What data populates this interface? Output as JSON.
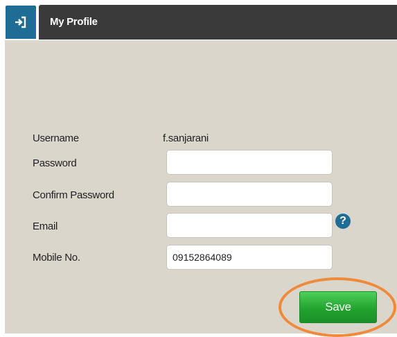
{
  "header": {
    "title": "My Profile",
    "exit_icon": "sign-in-arrow-icon"
  },
  "form": {
    "username_label": "Username",
    "username_value": "f.sanjarani",
    "password_label": "Password",
    "password_value": "",
    "confirm_password_label": "Confirm Password",
    "confirm_password_value": "",
    "email_label": "Email",
    "email_value": "",
    "email_help_icon": "question-circle-icon",
    "email_help_glyph": "?",
    "mobile_label": "Mobile No.",
    "mobile_value": "09152864089",
    "save_label": "Save"
  },
  "colors": {
    "header_dark": "#3a3a3a",
    "header_accent": "#1f6d95",
    "panel_bg": "#dad6cc",
    "save_green": "#23a32f",
    "highlight_orange": "#ee8a3a"
  }
}
